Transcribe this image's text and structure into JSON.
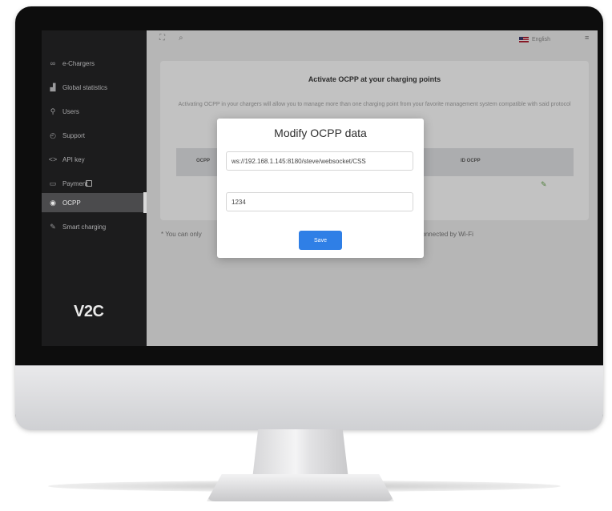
{
  "sidebar": {
    "items": [
      {
        "label": "e-Chargers",
        "icon": "infinity-icon",
        "active": false
      },
      {
        "label": "Global statistics",
        "icon": "bar-chart-icon",
        "active": false
      },
      {
        "label": "Users",
        "icon": "user-icon",
        "active": false
      },
      {
        "label": "Support",
        "icon": "support-icon",
        "active": false
      },
      {
        "label": "API key",
        "icon": "code-icon",
        "active": false
      },
      {
        "label": "Payment",
        "icon": "wallet-icon",
        "active": false
      },
      {
        "label": "OCPP",
        "icon": "globe-icon",
        "active": true
      },
      {
        "label": "Smart charging",
        "icon": "leaf-icon",
        "active": false
      }
    ],
    "logo": "V2C"
  },
  "topbar": {
    "language": "English"
  },
  "page": {
    "title": "Activate OCPP at your charging points",
    "description": "Activating OCPP in your chargers will allow you to manage more than one charging point from your favorite management system compatible with said protocol",
    "table_headers": [
      "OCPP",
      "ID OCPP"
    ],
    "footnote_left": "* You can only",
    "footnote_right": "e connected by Wi-Fi"
  },
  "modal": {
    "title": "Modify OCPP data",
    "url_value": "ws://192.168.1.145:8180/steve/websocket/CSS",
    "id_value": "1234",
    "save_label": "Save"
  },
  "colors": {
    "sidebar_bg": "#1c1c1d",
    "accent": "#2f7fe6",
    "edit_icon": "#6aa84f"
  }
}
